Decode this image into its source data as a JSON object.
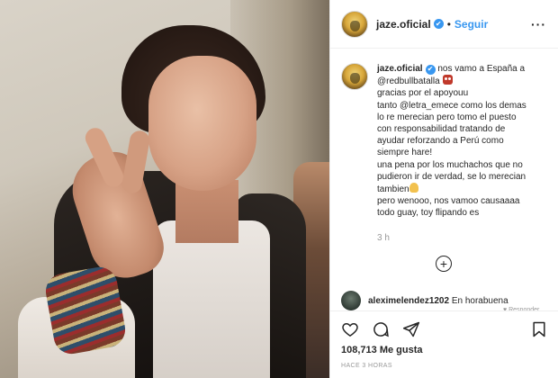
{
  "post": {
    "username": "jaze.oficial",
    "verified_mark": "✔",
    "dot": "•",
    "follow_label": "Seguir",
    "more_label": "···"
  },
  "caption": {
    "username": "jaze.oficial",
    "lines": [
      " nos vamo a España a",
      "@redbullbatalla",
      "gracias por el apoyouu",
      "tanto @letra_emece como los demas",
      "lo re merecian pero tomo el puesto",
      "con responsabilidad tratando de",
      "ayudar reforzando a Perú como",
      "siempre hare!",
      "una pena por los muchachos que no",
      "pudieron ir de verdad, se lo merecian",
      "tambien",
      "pero wenooo, nos vamoo causaaaa",
      "todo guay, toy flipando es"
    ],
    "time": "3 h",
    "emoji_owl": "owl-emoji",
    "emoji_pray": "pray-emoji"
  },
  "add_comment_icon": "plus-circle-icon",
  "comment": {
    "username": "aleximelendez1202",
    "text": " En horabuena",
    "subtext": "♥ Responder"
  },
  "actions": {
    "icons": [
      "heart-icon",
      "comment-icon",
      "share-icon",
      "bookmark-icon"
    ],
    "likes": "108,713 Me gusta",
    "ago": "HACE 3 HORAS"
  },
  "colors": {
    "link": "#3897f0",
    "text": "#262626",
    "muted": "#999999",
    "border": "#efefef"
  }
}
